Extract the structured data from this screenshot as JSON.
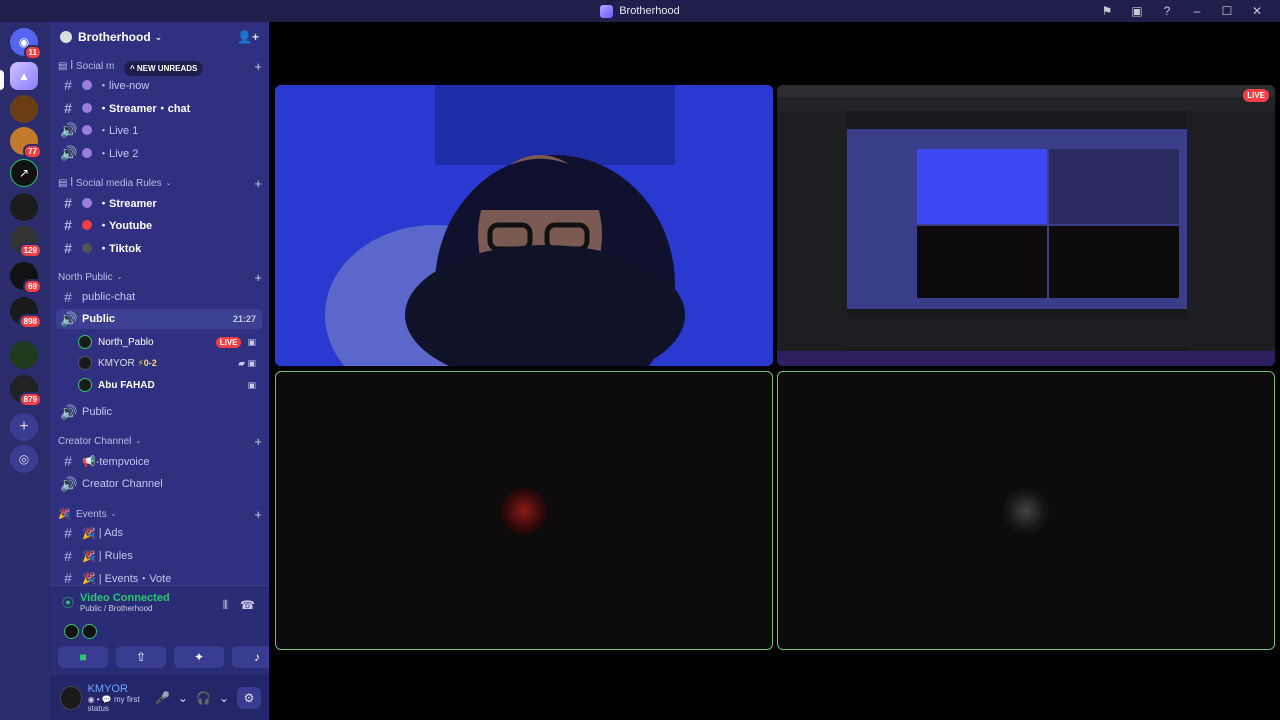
{
  "window": {
    "title": "Brotherhood"
  },
  "server_rail": {
    "servers": [
      {
        "name": "home",
        "badge": "11"
      },
      {
        "name": "active-server",
        "badge": ""
      },
      {
        "name": "server-3",
        "badge": ""
      },
      {
        "name": "server-4",
        "badge": "77"
      },
      {
        "name": "server-5",
        "badge": ""
      },
      {
        "name": "server-6",
        "badge": ""
      },
      {
        "name": "server-7",
        "badge": "129"
      },
      {
        "name": "server-8",
        "badge": "69"
      },
      {
        "name": "server-9",
        "badge": "898"
      },
      {
        "name": "server-10",
        "badge": ""
      },
      {
        "name": "server-11",
        "badge": "879"
      }
    ]
  },
  "guild": {
    "name": "Brotherhood"
  },
  "sidebar": {
    "new_unreads": "NEW UNREADS",
    "cat1_label": "Social m",
    "ch_live_now": "・live-now",
    "ch_streamer_chat": "・Streamer・chat",
    "ch_live1": "・Live 1",
    "ch_live2": "・Live 2",
    "cat2_label": "Social media Rules",
    "ch_streamer": "・Streamer",
    "ch_youtube": "・Youtube",
    "ch_tiktok": "・Tiktok",
    "cat3_label": "North Public",
    "ch_public_chat": "public-chat",
    "ch_public": "Public",
    "ch_public_timer": "21:27",
    "user1": "North_Pablo",
    "user1_live": "LIVE",
    "user2": "KMYOR",
    "user2_extra": "⚡0-2",
    "user3": "Abu FAHAD",
    "ch_public2": "Public",
    "cat4_label": "Creator Channel",
    "ch_tempvoice": "📢-tempvoice",
    "ch_creator": "Creator Channel",
    "cat5_label": "Events",
    "ch_ads": "| Ads",
    "ch_rules": "| Rules",
    "ch_events_vote": "| Events・Vote"
  },
  "voice_panel": {
    "status": "Video Connected",
    "location": "Public / Brotherhood"
  },
  "user_panel": {
    "username": "KMYOR",
    "status": "my first status"
  },
  "stage": {
    "screen_live": "LIVE"
  },
  "colors": {
    "rail": "#2b2c6b",
    "sidebar": "#2f3180",
    "connected_green": "#2dc770",
    "live_red": "#f23f43"
  }
}
